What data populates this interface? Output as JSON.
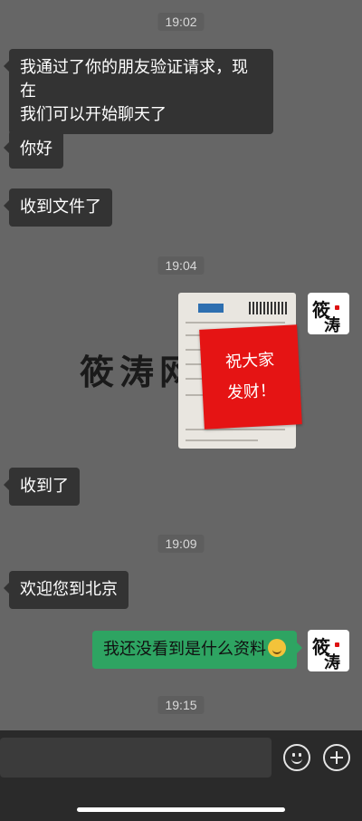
{
  "timestamps": [
    "19:02",
    "19:04",
    "19:09",
    "19:15"
  ],
  "messages": {
    "m1": {
      "text_line1": "我通过了你的朋友验证请求，现在",
      "text_line2": "我们可以开始聊天了"
    },
    "m2": {
      "text": "你好"
    },
    "m3": {
      "text": "收到文件了"
    },
    "m4": {
      "watermark": "筱涛网",
      "card_line1": "祝大家",
      "card_line2": "发财！"
    },
    "m5": {
      "text": "收到了"
    },
    "m6": {
      "text": "欢迎您到北京"
    },
    "m7": {
      "text": "我还没看到是什么资料"
    }
  },
  "avatar": {
    "char1": "筱",
    "char2": "涛"
  },
  "icons": {
    "emoji_button": "emoji-icon",
    "plus_button": "plus-icon",
    "inline_emoji": "grin-emoji-icon"
  },
  "colors": {
    "background": "#666666",
    "bubble_left": "#333333",
    "bubble_right": "#2ea462",
    "input_bar": "#2a2a2a",
    "red_card": "#e51414"
  }
}
